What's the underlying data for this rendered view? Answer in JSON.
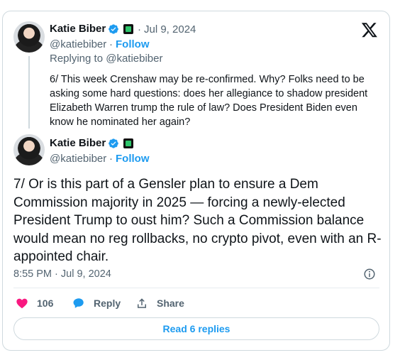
{
  "reply_tweet": {
    "author_name": "Katie Biber",
    "handle": "@katiebiber",
    "separator": "·",
    "date": "Jul 9, 2024",
    "follow_label": "Follow",
    "replying_to": "Replying to @katiebiber",
    "text": "6/ This week Crenshaw may be re-confirmed. Why? Folks need to be asking some hard questions: does her allegiance to shadow president Elizabeth Warren trump the rule of law? Does President Biden even know he nominated her again?"
  },
  "main_tweet": {
    "author_name": "Katie Biber",
    "handle": "@katiebiber",
    "separator": "·",
    "follow_label": "Follow",
    "text": "7/ Or is this part of a Gensler plan to ensure a Dem Commission majority in 2025 — forcing a newly-elected President Trump to oust him? Such a Commission balance would mean no reg rollbacks, no crypto pivot, even with an R-appointed chair.",
    "timestamp": "8:55 PM · Jul 9, 2024"
  },
  "actions": {
    "like_count": "106",
    "reply_label": "Reply",
    "share_label": "Share"
  },
  "read_replies_label": "Read 6 replies",
  "icons": {
    "platform": "x-logo-icon",
    "verified": "verified-badge-icon",
    "affiliation": "affiliation-badge-icon",
    "like": "heart-icon",
    "reply": "speech-bubble-icon",
    "share": "share-icon",
    "info": "info-icon"
  },
  "colors": {
    "accent": "#1d9bf0",
    "like": "#f91880",
    "muted": "#536471",
    "text": "#0f1419",
    "border": "#cfd9de"
  }
}
